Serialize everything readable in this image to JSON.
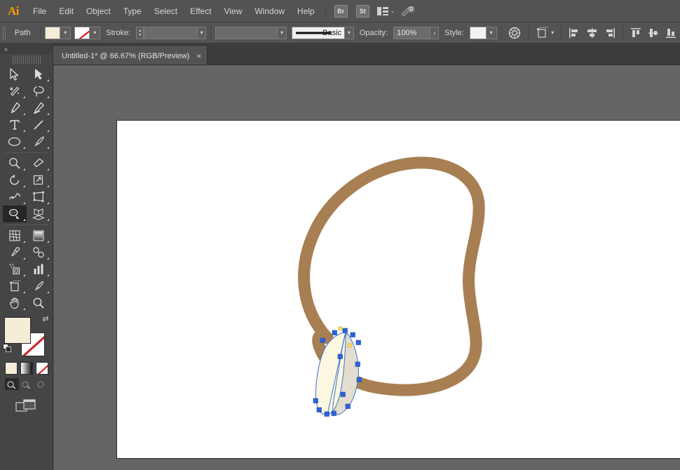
{
  "app": {
    "name": "Adobe Illustrator",
    "logo_text": "Ai"
  },
  "menu": {
    "items": [
      {
        "label": "File",
        "name": "menu-file"
      },
      {
        "label": "Edit",
        "name": "menu-edit"
      },
      {
        "label": "Object",
        "name": "menu-object"
      },
      {
        "label": "Type",
        "name": "menu-type"
      },
      {
        "label": "Select",
        "name": "menu-select"
      },
      {
        "label": "Effect",
        "name": "menu-effect"
      },
      {
        "label": "View",
        "name": "menu-view"
      },
      {
        "label": "Window",
        "name": "menu-window"
      },
      {
        "label": "Help",
        "name": "menu-help"
      }
    ],
    "bridge_label": "Br",
    "stock_label": "St",
    "arrange_icon": "arrange-documents-icon",
    "workspace_icon": "workspace-switcher-icon",
    "chevron": "⌄"
  },
  "control_bar": {
    "selection_type": "Path",
    "fill_label": "Fill",
    "fill_color": "#f5edd8",
    "stroke_swatch_label": "None",
    "stroke_label": "Stroke:",
    "stroke_weight": "",
    "variable_width_profile": "",
    "brush_definition": "Basic",
    "opacity_label": "Opacity:",
    "opacity_value": "100%",
    "style_label": "Style:",
    "style_value": "",
    "recolor_icon": "recolor-artwork-icon",
    "transform_icon": "transform-panel-icon",
    "align_icons": [
      "align-left-icon",
      "align-horizontal-center-icon",
      "align-right-icon",
      "align-top-icon",
      "align-vertical-center-icon",
      "align-bottom-icon"
    ]
  },
  "document": {
    "tab_title": "Untitled-1* @ 66.67% (RGB/Preview)",
    "close_label": "×",
    "zoom_level": "66.67%",
    "color_mode": "RGB",
    "view_mode": "Preview",
    "modified": true
  },
  "toolbar": {
    "collapse_label": "«",
    "tools": [
      {
        "name": "tool-selection",
        "label": "Selection Tool",
        "active": false
      },
      {
        "name": "tool-direct-selection",
        "label": "Direct Selection Tool",
        "active": false
      },
      {
        "name": "tool-magic-wand",
        "label": "Magic Wand Tool",
        "active": false
      },
      {
        "name": "tool-lasso",
        "label": "Lasso Tool",
        "active": false
      },
      {
        "name": "tool-pen",
        "label": "Pen Tool",
        "active": false
      },
      {
        "name": "tool-curvature",
        "label": "Curvature Tool",
        "active": false
      },
      {
        "name": "tool-type",
        "label": "Type Tool",
        "active": false
      },
      {
        "name": "tool-line-segment",
        "label": "Line Segment Tool",
        "active": false
      },
      {
        "name": "tool-ellipse",
        "label": "Ellipse Tool",
        "active": false
      },
      {
        "name": "tool-paintbrush",
        "label": "Paintbrush Tool",
        "active": false
      },
      {
        "name": "tool-shaper",
        "label": "Shaper Tool",
        "active": false
      },
      {
        "name": "tool-eraser",
        "label": "Eraser Tool",
        "active": false
      },
      {
        "name": "tool-rotate",
        "label": "Rotate Tool",
        "active": false
      },
      {
        "name": "tool-scale",
        "label": "Scale Tool",
        "active": false
      },
      {
        "name": "tool-width",
        "label": "Width Tool",
        "active": false
      },
      {
        "name": "tool-free-transform",
        "label": "Free Transform Tool",
        "active": false
      },
      {
        "name": "tool-shape-builder",
        "label": "Shape Builder Tool",
        "active": true
      },
      {
        "name": "tool-perspective-grid",
        "label": "Perspective Grid Tool",
        "active": false
      },
      {
        "name": "tool-mesh",
        "label": "Mesh Tool",
        "active": false
      },
      {
        "name": "tool-gradient",
        "label": "Gradient Tool",
        "active": false
      },
      {
        "name": "tool-eyedropper",
        "label": "Eyedropper Tool",
        "active": false
      },
      {
        "name": "tool-blend",
        "label": "Blend Tool",
        "active": false
      },
      {
        "name": "tool-symbol-sprayer",
        "label": "Symbol Sprayer Tool",
        "active": false
      },
      {
        "name": "tool-column-graph",
        "label": "Column Graph Tool",
        "active": false
      },
      {
        "name": "tool-artboard",
        "label": "Artboard Tool",
        "active": false
      },
      {
        "name": "tool-slice",
        "label": "Slice Tool",
        "active": false
      },
      {
        "name": "tool-hand",
        "label": "Hand Tool",
        "active": false
      },
      {
        "name": "tool-zoom",
        "label": "Zoom Tool",
        "active": false
      }
    ],
    "fill_color": "#f5edd8",
    "stroke_color": "none",
    "fill_label": "Fill",
    "stroke_label": "Stroke",
    "swap_label": "Swap Fill and Stroke",
    "default_label": "Default Fill and Stroke",
    "mode_buttons": [
      "color-mode-button",
      "gradient-mode-button",
      "none-mode-button"
    ],
    "draw_modes": [
      "draw-normal-button",
      "draw-behind-button",
      "draw-inside-button"
    ],
    "screen_mode": "change-screen-mode-button"
  },
  "artwork": {
    "background": "#ffffff",
    "canvas_background": "#656565",
    "shapes": [
      {
        "name": "brown-loop-path",
        "description": "Closed organic brown outline loop",
        "stroke_color": "#a87f52",
        "fill": "none"
      },
      {
        "name": "selected-leaf-shape-left",
        "description": "Left half of narrow leaf shape, cream fill",
        "fill_color": "#fbf7e0"
      },
      {
        "name": "selected-leaf-shape-right",
        "description": "Right half of narrow leaf shape, beige fill",
        "fill_color": "#e5e0d2"
      }
    ],
    "selection": {
      "path_color": "#3a6fd8",
      "anchor_color": "#2b63d9",
      "anchor_count": 14,
      "selected": true
    }
  }
}
